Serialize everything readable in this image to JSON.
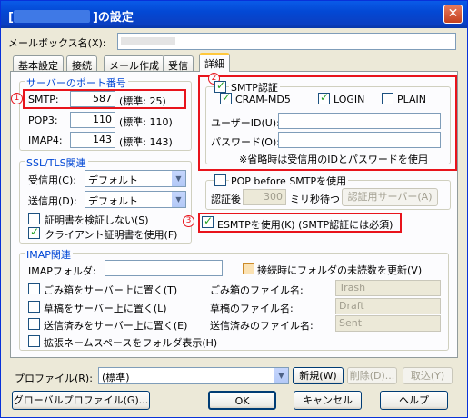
{
  "window": {
    "title_suffix": "の設定",
    "close_icon": "✕"
  },
  "mailbox": {
    "label": "メールボックス名(X):"
  },
  "tabs": [
    {
      "label": "基本設定"
    },
    {
      "label": "接続"
    },
    {
      "label": "メール作成"
    },
    {
      "label": "受信"
    },
    {
      "label": "詳細"
    }
  ],
  "server_port": {
    "title": "サーバーのポート番号",
    "smtp": {
      "label": "SMTP:",
      "value": "587",
      "default": "(標準: 25)"
    },
    "pop3": {
      "label": "POP3:",
      "value": "110",
      "default": "(標準: 110)"
    },
    "imap4": {
      "label": "IMAP4:",
      "value": "143",
      "default": "(標準: 143)"
    }
  },
  "ssl": {
    "title": "SSL/TLS関連",
    "recv_label": "受信用(C):",
    "recv_value": "デフォルト",
    "send_label": "送信用(D):",
    "send_value": "デフォルト",
    "no_verify": "証明書を検証しない(S)",
    "client_cert": "クライアント証明書を使用(F)"
  },
  "smtp_auth": {
    "title": "SMTP認証",
    "cram": "CRAM-MD5",
    "login": "LOGIN",
    "plain": "PLAIN",
    "user_label": "ユーザーID(U):",
    "pass_label": "パスワード(O):",
    "note": "※省略時は受信用のIDとパスワードを使用"
  },
  "pop_before": {
    "title": "POP before SMTPを使用",
    "wait_label": "認証後",
    "wait_value": "300",
    "wait_unit": "ミリ秒待つ",
    "server_button": "認証用サーバー(A)"
  },
  "esmtp": {
    "label": "ESMTPを使用(K) (SMTP認証には必須)"
  },
  "imap": {
    "title": "IMAP関連",
    "folder_label": "IMAPフォルダ:",
    "update_unread": "接続時にフォルダの未読数を更新(V)",
    "trash_server": "ごみ箱をサーバー上に置く(T)",
    "draft_server": "草稿をサーバー上に置く(L)",
    "sent_server": "送信済みをサーバー上に置く(E)",
    "ext_ns": "拡張ネームスペースをフォルダ表示(H)",
    "trash_label": "ごみ箱のファイル名:",
    "trash_value": "Trash",
    "draft_label": "草稿のファイル名:",
    "draft_value": "Draft",
    "sent_label": "送信済みのファイル名:",
    "sent_value": "Sent"
  },
  "profile": {
    "label": "プロファイル(R):",
    "value": "(標準)",
    "new": "新規(W)",
    "delete": "削除(D)...",
    "cancel": "取込(Y)"
  },
  "footer": {
    "global": "グローバルプロファイル(G)...",
    "ok": "OK",
    "cancel": "キャンセル",
    "help": "ヘルプ"
  },
  "markers": {
    "m1": "1",
    "m2": "2",
    "m3": "3"
  },
  "colors": {
    "accent_red": "#e8141c",
    "group_blue": "#0046d5",
    "title_bar": "#0348d4"
  }
}
